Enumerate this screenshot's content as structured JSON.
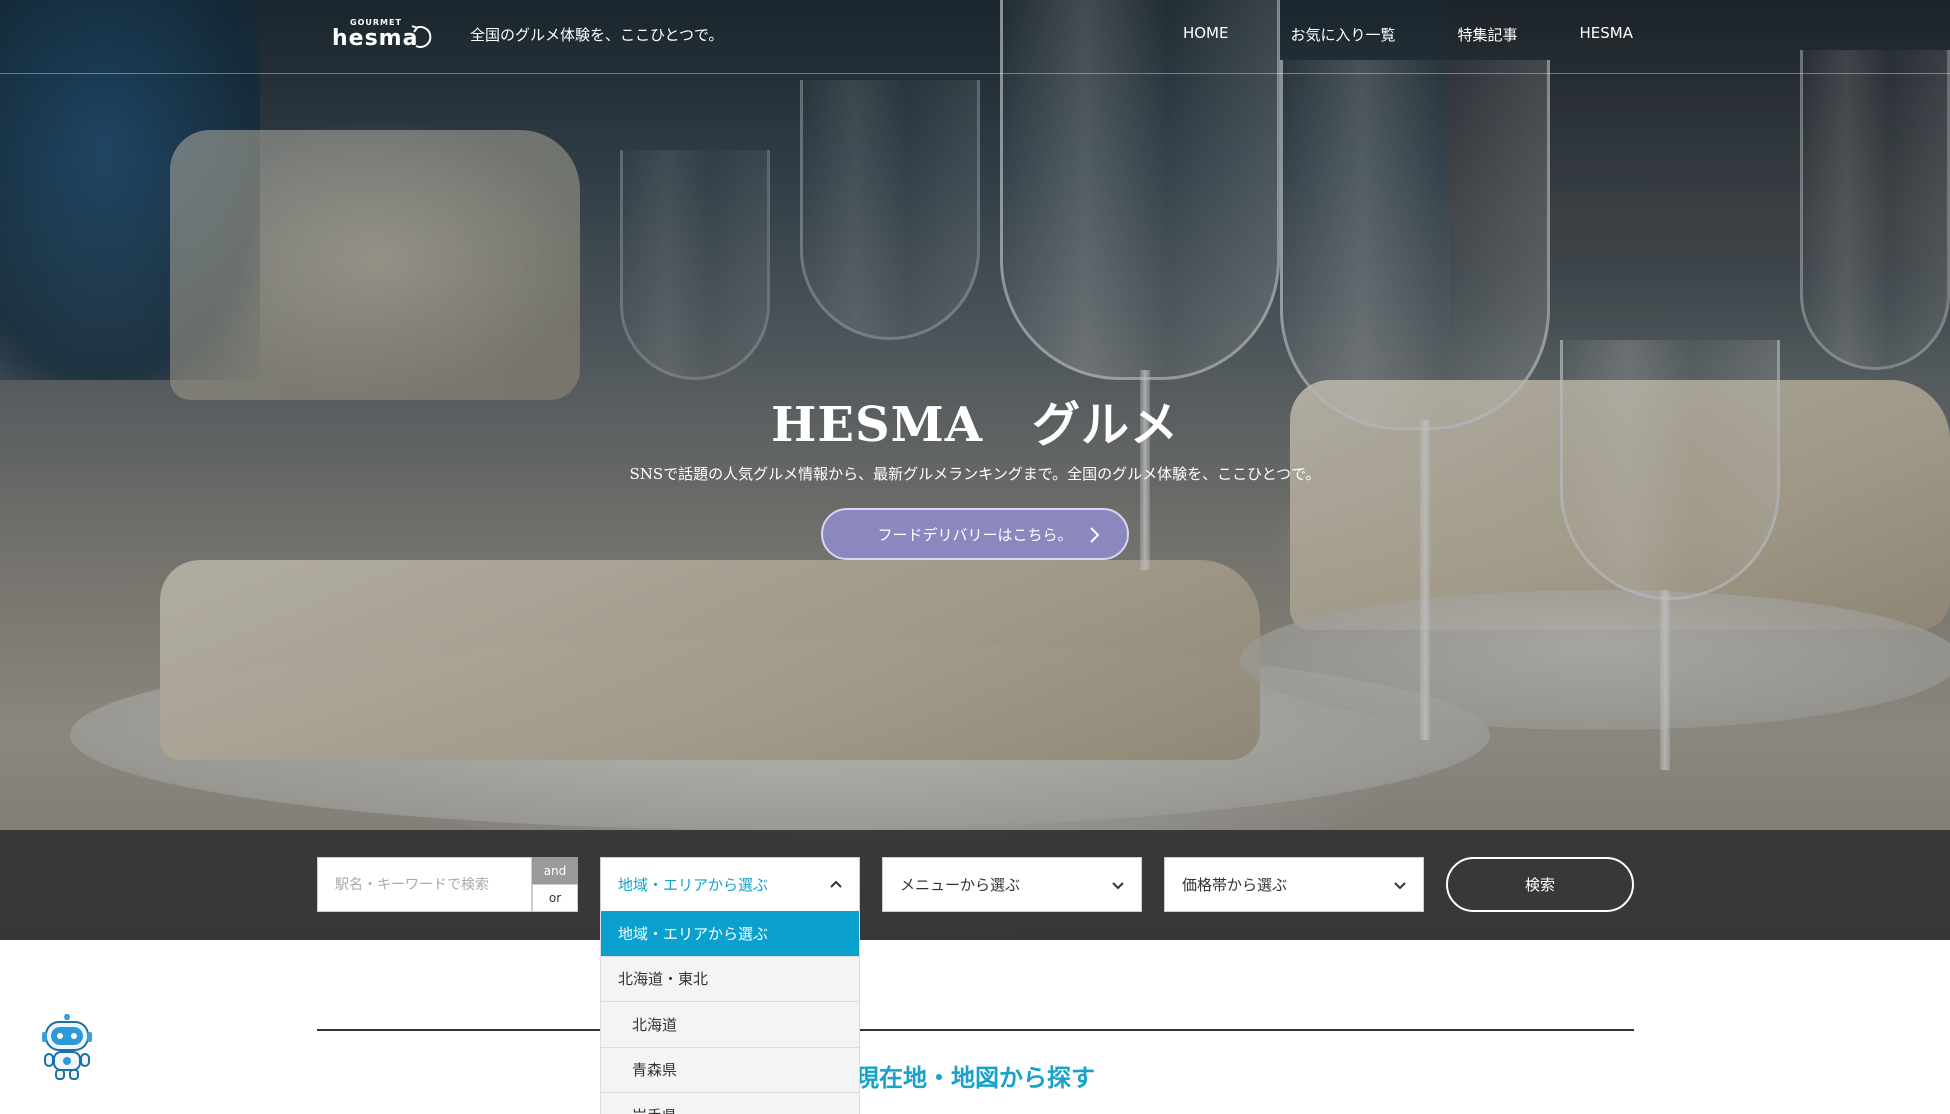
{
  "header": {
    "logo_small": "GOURMET",
    "logo_main": "hesma",
    "tagline": "全国のグルメ体験を、ここひとつで。",
    "nav": [
      "HOME",
      "お気に入り一覧",
      "特集記事",
      "HESMA"
    ]
  },
  "hero": {
    "title": "HESMA　グルメ",
    "subtitle": "SNSで話題の人気グルメ情報から、最新グルメランキングまで。全国のグルメ体験を、ここひとつで。",
    "cta_label": "フードデリバリーはこちら。"
  },
  "search": {
    "keyword_placeholder": "駅名・キーワードで検索",
    "and_label": "and",
    "or_label": "or",
    "area_select": "地域・エリアから選ぶ",
    "menu_select": "メニューから選ぶ",
    "price_select": "価格帯から選ぶ",
    "search_button": "検索"
  },
  "area_dropdown": {
    "options": [
      "地域・エリアから選ぶ",
      "北海道・東北",
      "北海道",
      "青森県",
      "岩手県"
    ],
    "selected": "地域・エリアから選ぶ"
  },
  "section": {
    "title": "現在地・地図から探す"
  },
  "colors": {
    "accent": "#16a2c9",
    "dropdown_selected": "#0aa1cf",
    "cta_bg": "#8b88bf"
  }
}
